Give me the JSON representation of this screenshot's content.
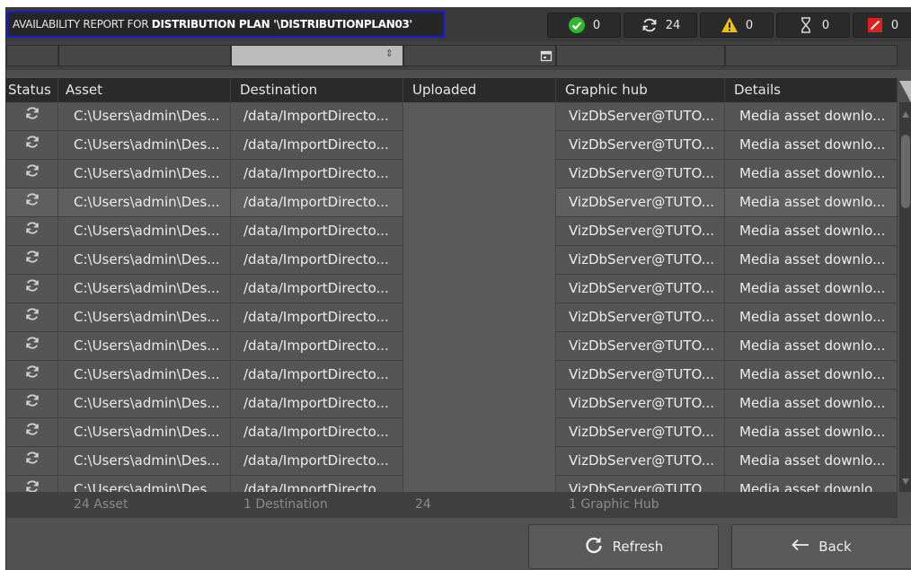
{
  "title": {
    "prefix": "AVAILABILITY REPORT FOR",
    "plan": "DISTRIBUTION PLAN '\\DISTRIBUTIONPLAN03'"
  },
  "counters": [
    {
      "icon": "check-circle-icon",
      "value": "0"
    },
    {
      "icon": "sync-icon",
      "value": "24"
    },
    {
      "icon": "warning-icon",
      "value": "0"
    },
    {
      "icon": "hourglass-icon",
      "value": "0"
    },
    {
      "icon": "error-icon",
      "value": "0"
    }
  ],
  "columns": [
    "Status",
    "Asset",
    "Destination",
    "Uploaded",
    "Graphic hub",
    "Details"
  ],
  "rows": [
    {
      "asset": "C:\\Users\\admin\\Des...",
      "destination": "/data/ImportDirecto...",
      "uploaded": "",
      "hub": "VizDbServer@TUTO...",
      "details": "Media asset downlo..."
    },
    {
      "asset": "C:\\Users\\admin\\Des...",
      "destination": "/data/ImportDirecto...",
      "uploaded": "",
      "hub": "VizDbServer@TUTO...",
      "details": "Media asset downlo..."
    },
    {
      "asset": "C:\\Users\\admin\\Des...",
      "destination": "/data/ImportDirecto...",
      "uploaded": "",
      "hub": "VizDbServer@TUTO...",
      "details": "Media asset downlo..."
    },
    {
      "asset": "C:\\Users\\admin\\Des...",
      "destination": "/data/ImportDirecto...",
      "uploaded": "",
      "hub": "VizDbServer@TUTO...",
      "details": "Media asset downlo..."
    },
    {
      "asset": "C:\\Users\\admin\\Des...",
      "destination": "/data/ImportDirecto...",
      "uploaded": "",
      "hub": "VizDbServer@TUTO...",
      "details": "Media asset downlo..."
    },
    {
      "asset": "C:\\Users\\admin\\Des...",
      "destination": "/data/ImportDirecto...",
      "uploaded": "",
      "hub": "VizDbServer@TUTO...",
      "details": "Media asset downlo..."
    },
    {
      "asset": "C:\\Users\\admin\\Des...",
      "destination": "/data/ImportDirecto...",
      "uploaded": "",
      "hub": "VizDbServer@TUTO...",
      "details": "Media asset downlo..."
    },
    {
      "asset": "C:\\Users\\admin\\Des...",
      "destination": "/data/ImportDirecto...",
      "uploaded": "",
      "hub": "VizDbServer@TUTO...",
      "details": "Media asset downlo..."
    },
    {
      "asset": "C:\\Users\\admin\\Des...",
      "destination": "/data/ImportDirecto...",
      "uploaded": "",
      "hub": "VizDbServer@TUTO...",
      "details": "Media asset downlo..."
    },
    {
      "asset": "C:\\Users\\admin\\Des...",
      "destination": "/data/ImportDirecto...",
      "uploaded": "",
      "hub": "VizDbServer@TUTO...",
      "details": "Media asset downlo..."
    },
    {
      "asset": "C:\\Users\\admin\\Des...",
      "destination": "/data/ImportDirecto...",
      "uploaded": "",
      "hub": "VizDbServer@TUTO...",
      "details": "Media asset downlo..."
    },
    {
      "asset": "C:\\Users\\admin\\Des...",
      "destination": "/data/ImportDirecto...",
      "uploaded": "",
      "hub": "VizDbServer@TUTO...",
      "details": "Media asset downlo..."
    },
    {
      "asset": "C:\\Users\\admin\\Des...",
      "destination": "/data/ImportDirecto...",
      "uploaded": "",
      "hub": "VizDbServer@TUTO...",
      "details": "Media asset downlo..."
    },
    {
      "asset": "C:\\Users\\admin\\Des...",
      "destination": "/data/ImportDirecto...",
      "uploaded": "",
      "hub": "VizDbServer@TUTO...",
      "details": "Media asset downlo..."
    }
  ],
  "highlighted_row": 3,
  "summary": {
    "asset": "24 Asset",
    "destination": "1 Destination",
    "uploaded": "24",
    "hub": "1 Graphic Hub"
  },
  "buttons": {
    "refresh": "Refresh",
    "back": "Back"
  },
  "colors": {
    "check": "#2eb82e",
    "warning": "#f2c200",
    "error": "#e02020",
    "title_border": "#1b1bd6"
  }
}
